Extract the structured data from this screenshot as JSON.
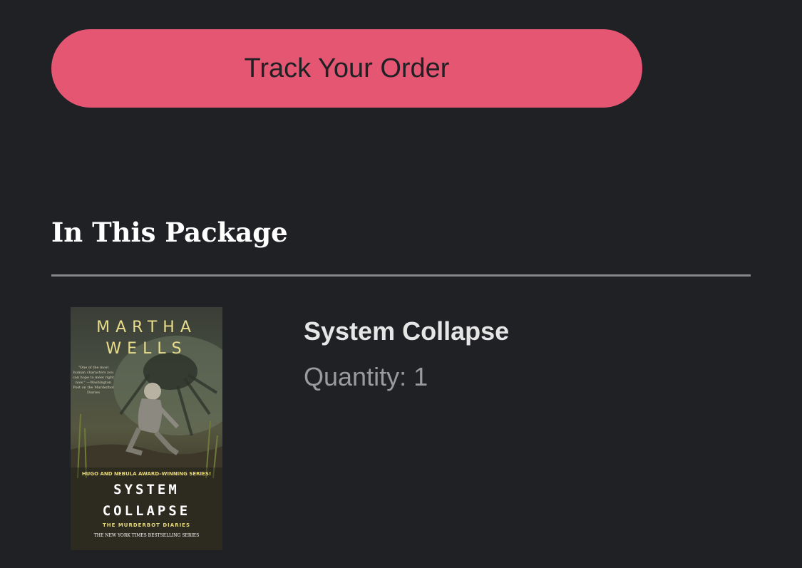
{
  "actions": {
    "track_order_label": "Track Your Order",
    "button_color": "#e45672"
  },
  "package": {
    "section_title": "In This Package",
    "items": [
      {
        "title": "System Collapse",
        "quantity_label": "Quantity: 1",
        "cover": {
          "author_line1": "MARTHA",
          "author_line2": "WELLS",
          "blurb": "\"One of the most human characters you can hope to meet right now.\" —Washington Post on the Murderbot Diaries",
          "award_line": "HUGO AND NEBULA AWARD–WINNING SERIES!",
          "title_line1": "SYSTEM",
          "title_line2": "COLLAPSE",
          "series": "THE MURDERBOT DIARIES",
          "bestseller": "THE NEW YORK TIMES BESTSELLING SERIES"
        }
      }
    ]
  },
  "colors": {
    "background": "#202125",
    "divider": "#85868a"
  }
}
